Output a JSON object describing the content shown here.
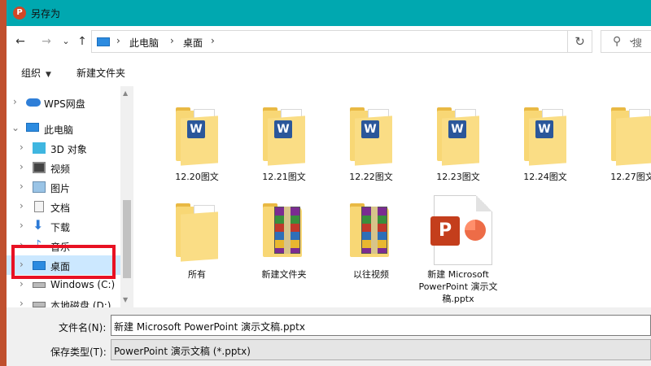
{
  "window": {
    "title": "另存为",
    "app_icon": "P"
  },
  "nav": {
    "back": "←",
    "forward": "→",
    "recent": "⌄",
    "up": "↑"
  },
  "address": {
    "crumbs": [
      "此电脑",
      "桌面"
    ],
    "separator": "›",
    "dropdown": "⌄",
    "refresh": "↻"
  },
  "search": {
    "icon": "⚲",
    "placeholder": "搜"
  },
  "toolbar": {
    "organize": "组织",
    "organize_caret": "▼",
    "new_folder": "新建文件夹"
  },
  "sidebar": {
    "items": [
      {
        "label": "WPS网盘",
        "icon": "cloud-icon",
        "chevron": "›"
      },
      {
        "label": "此电脑",
        "icon": "computer-icon",
        "chevron": "⌄"
      },
      {
        "label": "3D 对象",
        "icon": "cube-icon",
        "chevron": "›"
      },
      {
        "label": "视频",
        "icon": "video-icon",
        "chevron": "›"
      },
      {
        "label": "图片",
        "icon": "pictures-icon",
        "chevron": "›"
      },
      {
        "label": "文档",
        "icon": "document-icon",
        "chevron": "›"
      },
      {
        "label": "下载",
        "icon": "download-icon",
        "chevron": "›"
      },
      {
        "label": "音乐",
        "icon": "music-icon",
        "chevron": "›"
      },
      {
        "label": "桌面",
        "icon": "desktop-icon",
        "chevron": "›"
      },
      {
        "label": "Windows (C:)",
        "icon": "drive-icon",
        "chevron": "›"
      },
      {
        "label": "本地磁盘 (D:)",
        "icon": "drive-icon",
        "chevron": "›"
      }
    ]
  },
  "files": [
    {
      "name": "12.20图文",
      "type": "word-folder"
    },
    {
      "name": "12.21图文",
      "type": "word-folder"
    },
    {
      "name": "12.22图文",
      "type": "word-folder"
    },
    {
      "name": "12.23图文",
      "type": "word-folder"
    },
    {
      "name": "12.24图文",
      "type": "word-folder"
    },
    {
      "name": "12.27图文",
      "type": "folder"
    },
    {
      "name": "所有",
      "type": "folder"
    },
    {
      "name": "新建文件夹",
      "type": "rar-folder"
    },
    {
      "name": "以往视频",
      "type": "rar-folder"
    },
    {
      "name": "新建 Microsoft PowerPoint 演示文稿.pptx",
      "type": "pptx"
    }
  ],
  "bottom": {
    "filename_label": "文件名(N):",
    "filename_value": "新建 Microsoft PowerPoint 演示文稿.pptx",
    "filetype_label": "保存类型(T):",
    "filetype_value": "PowerPoint 演示文稿 (*.pptx)"
  },
  "colors": {
    "titlebar": "#00a8b0",
    "selected": "#cce8ff",
    "annotation": "#e81123"
  }
}
